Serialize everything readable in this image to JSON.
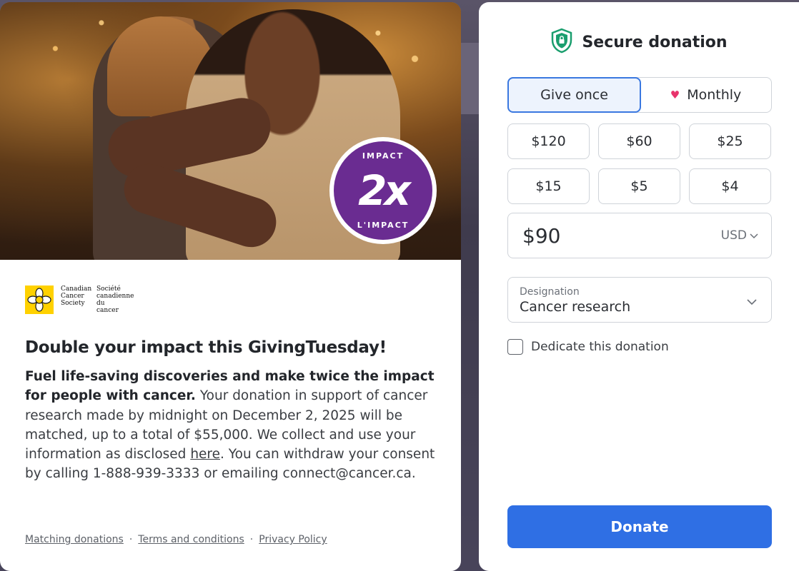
{
  "campaign": {
    "badge_top": "IMPACT",
    "badge_big": "2x",
    "badge_bottom": "L'IMPACT",
    "logo": {
      "en_line1": "Canadian",
      "en_line2": "Cancer",
      "en_line3": "Society",
      "fr_line1": "Société",
      "fr_line2": "canadienne",
      "fr_line3": "du cancer"
    },
    "headline": "Double your impact this GivingTuesday!",
    "lead": "Fuel life-saving discoveries and make twice the impact for people with cancer.",
    "body_part1": " Your donation in support of cancer research made by midnight on December 2, 2025 will be matched, up to a total of $55,000. We collect and use your information as disclosed ",
    "link_here": "here",
    "body_part2": ". You can withdraw your consent by calling 1-888-939-3333 or emailing connect@cancer.ca.",
    "footer": {
      "matching": "Matching donations",
      "terms": "Terms and conditions",
      "privacy": "Privacy Policy",
      "separator": "·"
    }
  },
  "form": {
    "title": "Secure donation",
    "frequency": {
      "once": "Give once",
      "monthly": "Monthly",
      "selected": "once"
    },
    "amounts": [
      "$120",
      "$60",
      "$25",
      "$15",
      "$5",
      "$4"
    ],
    "custom_amount": "$90",
    "currency": "USD",
    "designation": {
      "label": "Designation",
      "value": "Cancer research"
    },
    "dedicate_label": "Dedicate this donation",
    "donate_label": "Donate"
  },
  "colors": {
    "accent": "#2f6fe4",
    "badge_purple": "#6a2c91",
    "logo_yellow": "#ffd100",
    "heart": "#e8336c",
    "shield_green": "#1a9e6e"
  }
}
